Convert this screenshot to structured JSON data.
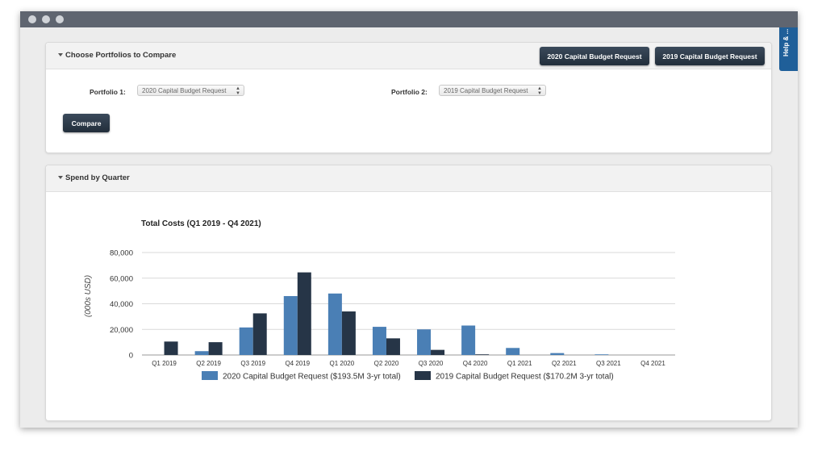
{
  "window": {
    "help_tab": "Help & ..."
  },
  "portfolios_panel": {
    "title": "Choose Portfolios to Compare",
    "btn_2020": "2020 Capital Budget Request",
    "btn_2019": "2019 Capital Budget Request",
    "portfolio1_label": "Portfolio 1:",
    "portfolio1_value": "2020 Capital Budget Request",
    "portfolio2_label": "Portfolio 2:",
    "portfolio2_value": "2019 Capital Budget Request",
    "compare_label": "Compare"
  },
  "spend_panel": {
    "title": "Spend by Quarter"
  },
  "colors": {
    "series_2020": "#4a7fb5",
    "series_2019": "#263547",
    "grid": "#d9d9d9"
  },
  "chart_data": {
    "type": "bar",
    "title": "Total Costs (Q1 2019 - Q4 2021)",
    "xlabel": "",
    "ylabel": "(000s USD)",
    "ylim": [
      0,
      80000
    ],
    "yticks": [
      0,
      20000,
      40000,
      60000,
      80000
    ],
    "ytick_labels": [
      "0",
      "20,000",
      "40,000",
      "60,000",
      "80,000"
    ],
    "grid": true,
    "legend_position": "bottom",
    "categories": [
      "Q1 2019",
      "Q2 2019",
      "Q3 2019",
      "Q4 2019",
      "Q1 2020",
      "Q2 2020",
      "Q3 2020",
      "Q4 2020",
      "Q1 2021",
      "Q2 2021",
      "Q3 2021",
      "Q4 2021"
    ],
    "series": [
      {
        "name": "2020 Capital Budget Request ($193.5M 3-yr total)",
        "values": [
          0,
          3000,
          21500,
          46000,
          48000,
          22000,
          20000,
          23000,
          5500,
          1500,
          500,
          0
        ]
      },
      {
        "name": "2019 Capital Budget Request ($170.2M 3-yr total)",
        "values": [
          10500,
          10000,
          32500,
          64500,
          34000,
          13000,
          4000,
          500,
          0,
          0,
          0,
          0
        ]
      }
    ]
  }
}
